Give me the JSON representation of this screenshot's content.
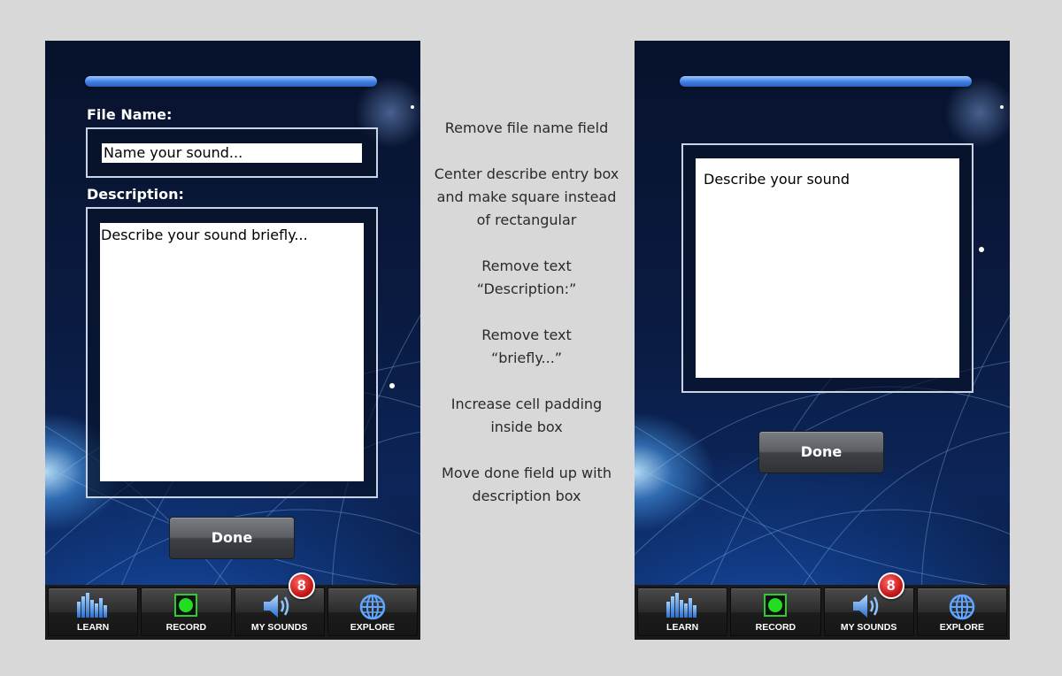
{
  "before_screen": {
    "file_name_label": "File Name:",
    "file_name_placeholder": "Name your sound...",
    "description_label": "Description:",
    "description_placeholder": "Describe your sound briefly...",
    "done_label": "Done"
  },
  "after_screen": {
    "description_placeholder": "Describe your sound",
    "done_label": "Done"
  },
  "tabbar": {
    "tabs": [
      {
        "label": "LEARN",
        "icon": "equalizer-icon"
      },
      {
        "label": "RECORD",
        "icon": "record-icon"
      },
      {
        "label": "MY SOUNDS",
        "icon": "speaker-icon"
      },
      {
        "label": "EXPLORE",
        "icon": "globe-icon"
      }
    ],
    "badge_count": "8"
  },
  "notes": [
    "Remove file name field",
    "Center describe entry box\nand make square instead\nof rectangular",
    "Remove text\n“Description:”",
    "Remove text\n“briefly...”",
    "Increase cell padding\ninside box",
    "Move done field up with\ndescription box"
  ],
  "colors": {
    "page_background": "#d8d8d8",
    "accent_bar": "#3f7fe0",
    "badge": "#c81818",
    "record_green": "#22dd22"
  }
}
